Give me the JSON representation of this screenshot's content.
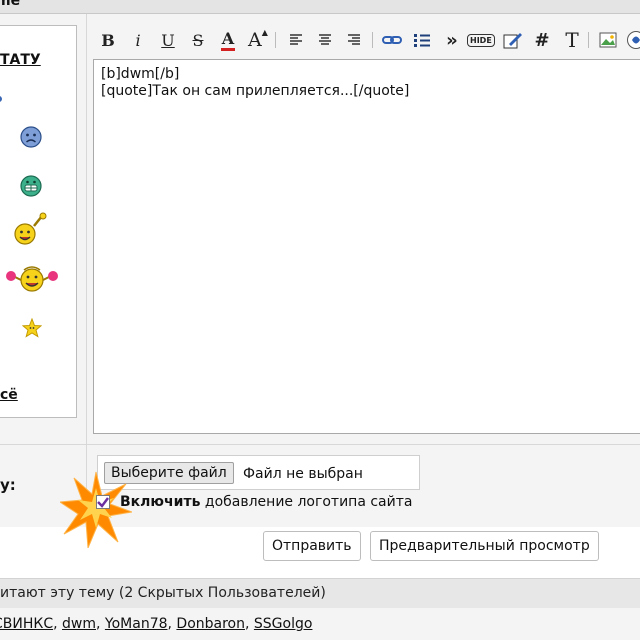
{
  "header": {
    "title_fragment": "me"
  },
  "smilies": {
    "title": "ТАТУ",
    "show_all": "сё",
    "items": [
      {
        "icon": "sad-smiley-icon"
      },
      {
        "icon": "grin-smiley-icon"
      },
      {
        "icon": "waving-smiley-icon"
      },
      {
        "icon": "cheering-smiley-icon"
      },
      {
        "icon": "star-smiley-icon"
      }
    ]
  },
  "toolbar": {
    "buttons": [
      {
        "label": "B",
        "icon": "bold-icon"
      },
      {
        "label": "i",
        "icon": "italic-icon"
      },
      {
        "label": "U",
        "icon": "underline-icon"
      },
      {
        "label": "S",
        "icon": "strikethrough-icon"
      },
      {
        "label": "A",
        "icon": "font-color-icon"
      },
      {
        "label": "A",
        "icon": "font-size-icon"
      },
      {
        "icon": "align-left-icon"
      },
      {
        "icon": "align-center-icon"
      },
      {
        "icon": "align-right-icon"
      },
      {
        "icon": "link-icon"
      },
      {
        "icon": "list-icon"
      },
      {
        "label": "»",
        "icon": "quote-icon"
      },
      {
        "label": "HIDE",
        "icon": "hide-icon"
      },
      {
        "icon": "edit-icon"
      },
      {
        "label": "#",
        "icon": "code-icon"
      },
      {
        "label": "T",
        "icon": "text-icon"
      },
      {
        "icon": "image-icon"
      },
      {
        "icon": "video-icon"
      }
    ]
  },
  "editor": {
    "content": "[b]dwm[/b]\n[quote]Так он сам прилепляется...[/quote]"
  },
  "attachments": {
    "label": "у:",
    "choose_file": "Выберите файл",
    "no_file": "Файл не выбран"
  },
  "logo_option": {
    "bold": "Включить",
    "rest": "добавление логотипа сайта",
    "checked": true
  },
  "actions": {
    "submit": "Отправить",
    "preview": "Предварительный просмотр"
  },
  "readers": {
    "text": "итают эту тему (2 Скрытых Пользователей)",
    "users": [
      "СВИНКС",
      "dwm",
      "YoMan78",
      "Donbaron",
      "SSGolgo"
    ],
    "separator": ", "
  },
  "colors": {
    "page_bg": "#f4f4f4",
    "font_color_bar": "#d32020",
    "link_blue": "#2f5fb3",
    "star_orange": "#ff8a00"
  }
}
